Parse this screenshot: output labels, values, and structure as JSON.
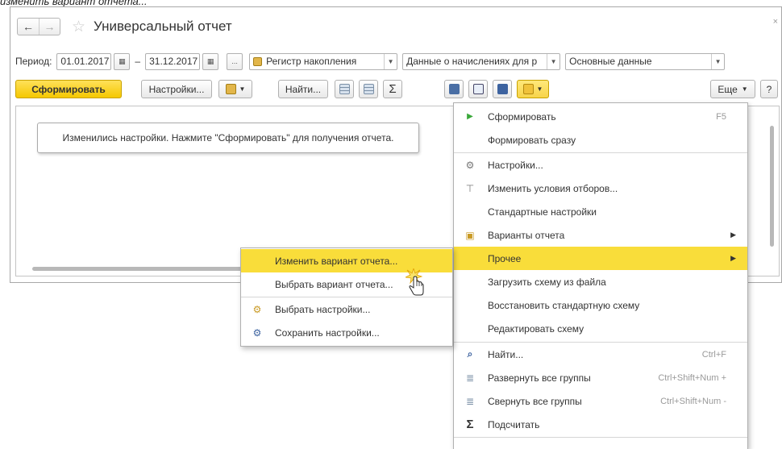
{
  "caption": "изменить вариант отчета...",
  "window": {
    "title": "Универсальный отчет",
    "close": "×"
  },
  "nav": {
    "back": "←",
    "forward": "→",
    "favorite": "☆"
  },
  "period": {
    "label": "Период:",
    "from": "01.01.2017",
    "dash": "–",
    "to": "31.12.2017",
    "more": "...",
    "source_type": "Регистр накопления",
    "source": "Данные о начислениях для р",
    "variant": "Основные данные"
  },
  "toolbar": {
    "generate": "Сформировать",
    "settings": "Настройки...",
    "find": "Найти...",
    "sum": "Σ",
    "more": "Еще",
    "help": "?"
  },
  "notice": "Изменились настройки. Нажмите \"Сформировать\" для получения отчета.",
  "main_menu": {
    "items": [
      {
        "icon": "play-icon",
        "glyph": "▶",
        "label": "Сформировать",
        "shortcut": "F5"
      },
      {
        "icon": "",
        "glyph": "",
        "label": "Формировать сразу",
        "shortcut": ""
      },
      {
        "icon": "settings-icon",
        "glyph": "⚙",
        "label": "Настройки...",
        "shortcut": ""
      },
      {
        "icon": "filter-icon",
        "glyph": "⊤",
        "label": "Изменить условия отборов...",
        "shortcut": ""
      },
      {
        "icon": "",
        "glyph": "",
        "label": "Стандартные настройки",
        "shortcut": ""
      },
      {
        "icon": "variants-icon",
        "glyph": "▣",
        "label": "Варианты отчета",
        "shortcut": ""
      },
      {
        "icon": "",
        "glyph": "",
        "label": "Прочее",
        "shortcut": ""
      },
      {
        "icon": "",
        "glyph": "",
        "label": "Загрузить схему из файла",
        "shortcut": ""
      },
      {
        "icon": "",
        "glyph": "",
        "label": "Восстановить стандартную схему",
        "shortcut": ""
      },
      {
        "icon": "",
        "glyph": "",
        "label": "Редактировать схему",
        "shortcut": ""
      },
      {
        "icon": "search-icon",
        "glyph": "⌕",
        "label": "Найти...",
        "shortcut": "Ctrl+F"
      },
      {
        "icon": "expand-groups-icon",
        "glyph": "≣",
        "label": "Развернуть все группы",
        "shortcut": "Ctrl+Shift+Num +"
      },
      {
        "icon": "collapse-groups-icon",
        "glyph": "≣",
        "label": "Свернуть все группы",
        "shortcut": "Ctrl+Shift+Num -"
      },
      {
        "icon": "sum-icon",
        "glyph": "Σ",
        "label": "Подсчитать",
        "shortcut": ""
      }
    ]
  },
  "sub_menu": {
    "items": [
      {
        "icon": "",
        "glyph": "",
        "label": "Изменить вариант отчета..."
      },
      {
        "icon": "",
        "glyph": "",
        "label": "Выбрать вариант отчета..."
      },
      {
        "icon": "settings-select-icon",
        "glyph": "⚙",
        "label": "Выбрать настройки..."
      },
      {
        "icon": "settings-save-icon",
        "glyph": "⚙",
        "label": "Сохранить настройки..."
      }
    ]
  },
  "colors": {
    "accent": "#f5c800",
    "highlight": "#f9dd3a",
    "border": "#b0b0b0"
  }
}
